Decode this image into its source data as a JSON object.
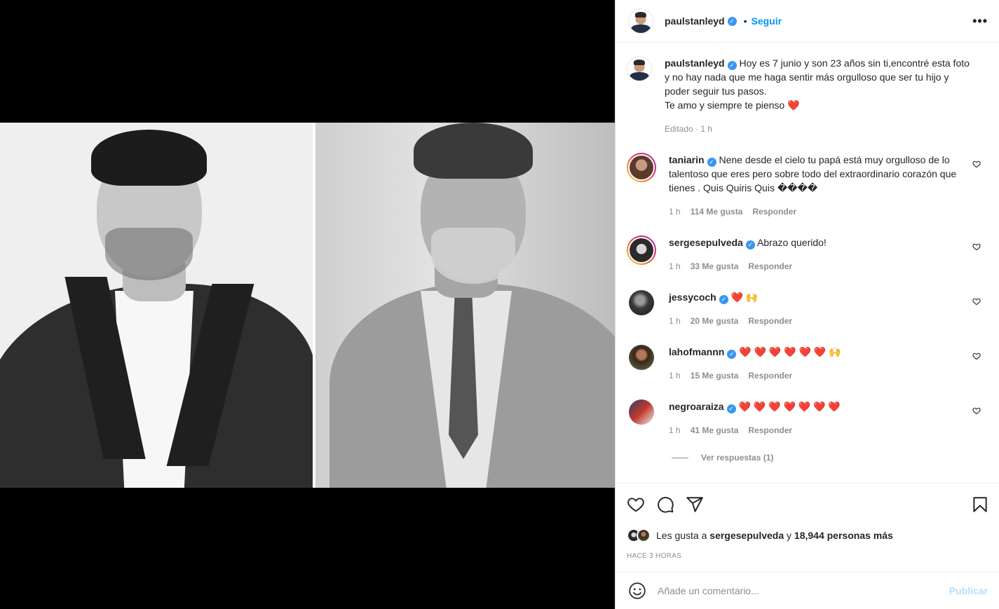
{
  "post": {
    "author": "paulstanleyd",
    "follow_label": "Seguir",
    "separator": "•",
    "more_label": "•••",
    "caption_text": "Hoy es 7 junio y son 23 años sin ti,encontré esta foto y no hay nada que me haga sentir más orgulloso que ser tu hijo y poder seguir tus pasos.\nTe amo y siempre te pienso ",
    "caption_heart": "❤️",
    "caption_meta": "Editado · 1 h"
  },
  "comments": [
    {
      "user": "taniarin",
      "text": "Nene desde el cielo tu papá está muy orgulloso de lo talentoso que eres pero sobre todo del extraordinario corazón que tienes . Quis Quiris Quis ����",
      "time": "1 h",
      "likes": "114 Me gusta",
      "reply": "Responder"
    },
    {
      "user": "sergesepulveda",
      "text": "Abrazo querido!",
      "time": "1 h",
      "likes": "33 Me gusta",
      "reply": "Responder"
    },
    {
      "user": "jessycoch",
      "text": "❤️ 🙌",
      "time": "1 h",
      "likes": "20 Me gusta",
      "reply": "Responder"
    },
    {
      "user": "lahofmannn",
      "text": "❤️ ❤️ ❤️ ❤️ ❤️ ❤️ 🙌",
      "time": "1 h",
      "likes": "15 Me gusta",
      "reply": "Responder"
    },
    {
      "user": "negroaraiza",
      "text": "❤️ ❤️ ❤️ ❤️ ❤️ ❤️ ❤️",
      "time": "1 h",
      "likes": "41 Me gusta",
      "reply": "Responder"
    }
  ],
  "view_replies": "Ver respuestas (1)",
  "likes": {
    "prefix": "Les gusta a ",
    "user": "sergesepulveda",
    "middle": " y ",
    "count": "18,944 personas más"
  },
  "timestamp": "HACE 3 HORAS",
  "composer": {
    "placeholder": "Añade un comentario...",
    "publish": "Publicar"
  },
  "icons": {
    "verified": "verified-badge-icon",
    "like": "heart-icon",
    "comment": "comment-bubble-icon",
    "share": "paper-plane-icon",
    "save": "bookmark-icon",
    "emoji": "emoji-smile-icon"
  },
  "colors": {
    "accent": "#0095f6",
    "verified": "#3897f0",
    "heart": "#ed4956",
    "muted": "#8e8e8e"
  }
}
